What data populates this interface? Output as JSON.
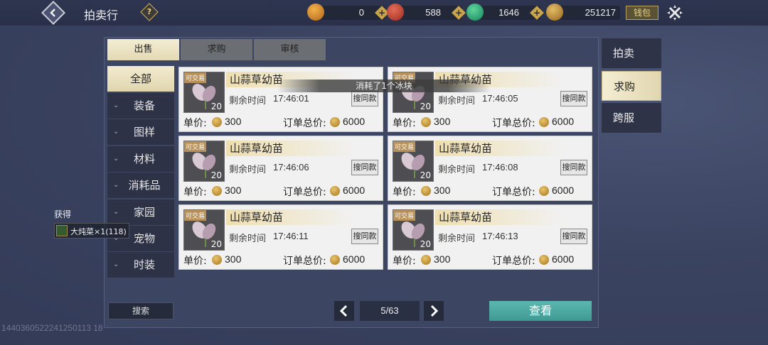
{
  "header": {
    "title": "拍卖行",
    "help_symbol": "?",
    "wallet_label": "钱包",
    "currencies": [
      {
        "icon": "gold-ingot-icon",
        "value": "0",
        "color": "#d8892a"
      },
      {
        "icon": "red-orb-icon",
        "value": "588",
        "color": "#c8483a"
      },
      {
        "icon": "jade-icon",
        "value": "1646",
        "color": "#2fb07a"
      },
      {
        "icon": "silver-coin-icon",
        "value": "251217",
        "color": "#c49440"
      }
    ]
  },
  "top_tabs": [
    "出售",
    "求购",
    "审核"
  ],
  "categories": [
    {
      "label": "全部",
      "active": true
    },
    {
      "label": "装备"
    },
    {
      "label": "图样"
    },
    {
      "label": "材料"
    },
    {
      "label": "消耗品"
    },
    {
      "label": "家园"
    },
    {
      "label": "宠物"
    },
    {
      "label": "时装"
    }
  ],
  "listing_labels": {
    "tradeable": "可交易",
    "remaining": "剩余时间",
    "search_same": "搜同款",
    "unit_price": "单价:",
    "total_price": "订单总价:"
  },
  "listings": [
    {
      "name": "山蒜草幼苗",
      "qty": "20",
      "time": "17:46:01",
      "unit": "300",
      "total": "6000"
    },
    {
      "name": "山蒜草幼苗",
      "qty": "20",
      "time": "17:46:05",
      "unit": "300",
      "total": "6000"
    },
    {
      "name": "山蒜草幼苗",
      "qty": "20",
      "time": "17:46:06",
      "unit": "300",
      "total": "6000"
    },
    {
      "name": "山蒜草幼苗",
      "qty": "20",
      "time": "17:46:08",
      "unit": "300",
      "total": "6000"
    },
    {
      "name": "山蒜草幼苗",
      "qty": "20",
      "time": "17:46:11",
      "unit": "300",
      "total": "6000"
    },
    {
      "name": "山蒜草幼苗",
      "qty": "20",
      "time": "17:46:13",
      "unit": "300",
      "total": "6000"
    }
  ],
  "toast": "消耗了1个冰块",
  "bottom": {
    "search_label": "搜索",
    "page": "5/63",
    "view_label": "查看"
  },
  "right_tabs": [
    "拍卖",
    "求购",
    "跨服"
  ],
  "gain": {
    "title": "获得",
    "item": "大炖菜×1(118)"
  },
  "footer_id": "1440360522241250113 18"
}
